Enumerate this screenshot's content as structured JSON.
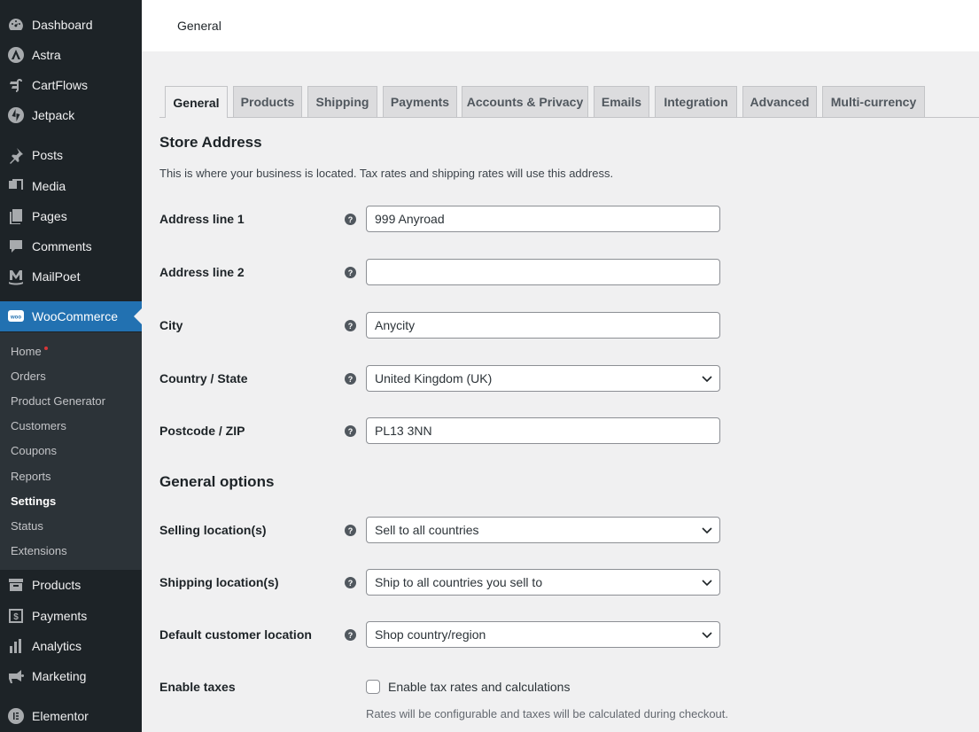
{
  "sidebar": {
    "menu": [
      {
        "label": "Dashboard",
        "icon": "dashboard-icon"
      },
      {
        "label": "Astra",
        "icon": "astra-icon"
      },
      {
        "label": "CartFlows",
        "icon": "cartflows-icon"
      },
      {
        "label": "Jetpack",
        "icon": "jetpack-icon"
      },
      {
        "label": "Posts",
        "icon": "pin-icon"
      },
      {
        "label": "Media",
        "icon": "media-icon"
      },
      {
        "label": "Pages",
        "icon": "pages-icon"
      },
      {
        "label": "Comments",
        "icon": "comment-icon"
      },
      {
        "label": "MailPoet",
        "icon": "mailpoet-icon"
      },
      {
        "label": "WooCommerce",
        "icon": "woo-icon"
      },
      {
        "label": "Products",
        "icon": "archive-icon"
      },
      {
        "label": "Payments",
        "icon": "dollar-icon"
      },
      {
        "label": "Analytics",
        "icon": "bar-chart-icon"
      },
      {
        "label": "Marketing",
        "icon": "megaphone-icon"
      },
      {
        "label": "Elementor",
        "icon": "elementor-icon"
      }
    ],
    "submenu": [
      "Home",
      "Orders",
      "Product Generator",
      "Customers",
      "Coupons",
      "Reports",
      "Settings",
      "Status",
      "Extensions"
    ],
    "active_color": "#2271b1"
  },
  "header": {
    "title": "General"
  },
  "tabs": [
    "General",
    "Products",
    "Shipping",
    "Payments",
    "Accounts & Privacy",
    "Emails",
    "Integration",
    "Advanced",
    "Multi-currency"
  ],
  "store_address": {
    "title": "Store Address",
    "description": "This is where your business is located. Tax rates and shipping rates will use this address.",
    "address1": {
      "label": "Address line 1",
      "value": "999 Anyroad"
    },
    "address2": {
      "label": "Address line 2",
      "value": ""
    },
    "city": {
      "label": "City",
      "value": "Anycity"
    },
    "country": {
      "label": "Country / State",
      "value": "United Kingdom (UK)"
    },
    "postcode": {
      "label": "Postcode / ZIP",
      "value": "PL13 3NN"
    }
  },
  "general_options": {
    "title": "General options",
    "selling": {
      "label": "Selling location(s)",
      "value": "Sell to all countries"
    },
    "shipping": {
      "label": "Shipping location(s)",
      "value": "Ship to all countries you sell to"
    },
    "default_location": {
      "label": "Default customer location",
      "value": "Shop country/region"
    },
    "taxes": {
      "label": "Enable taxes",
      "checkbox_label": "Enable tax rates and calculations",
      "checked": false,
      "description": "Rates will be configurable and taxes will be calculated during checkout."
    }
  },
  "help_glyph": "?"
}
